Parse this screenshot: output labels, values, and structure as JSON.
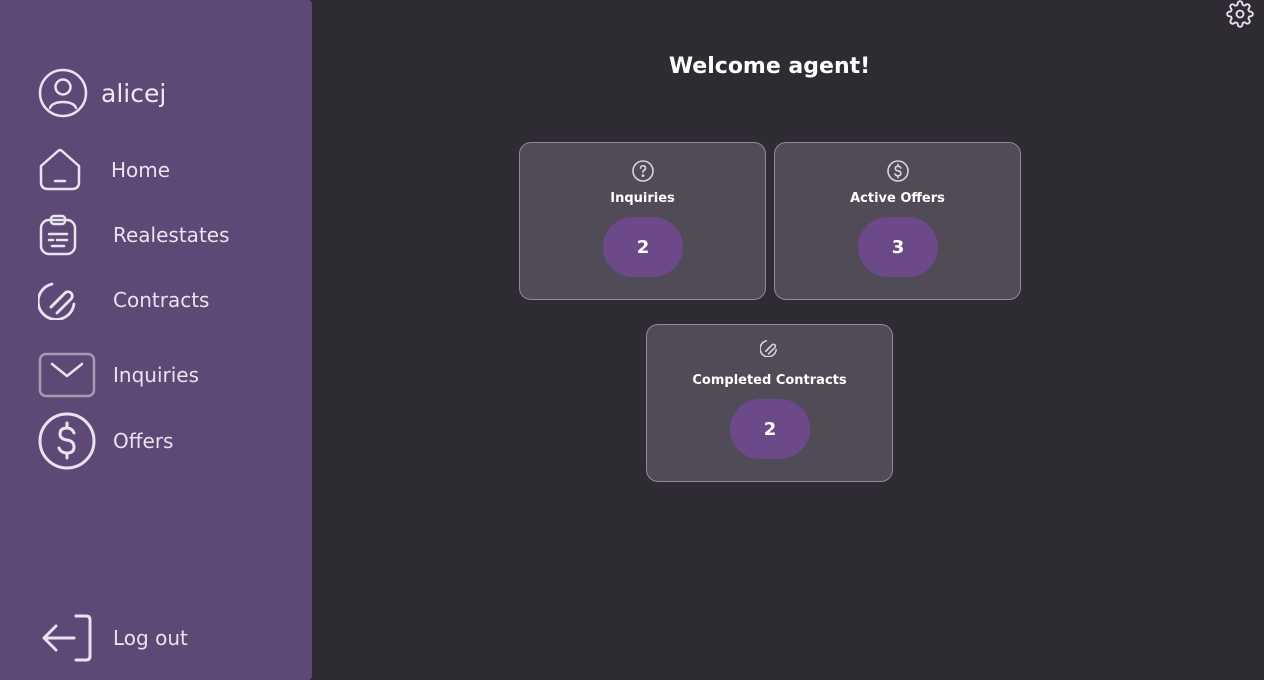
{
  "sidebar": {
    "user": {
      "name": "alicej",
      "icon": "user-circle-icon"
    },
    "items": [
      {
        "label": "Home",
        "icon": "home-icon"
      },
      {
        "label": "Realestates",
        "icon": "clipboard-icon"
      },
      {
        "label": "Contracts",
        "icon": "paperclip-icon"
      },
      {
        "label": "Inquiries",
        "icon": "envelope-icon"
      },
      {
        "label": "Offers",
        "icon": "dollar-circle-icon"
      }
    ],
    "logout": {
      "label": "Log out",
      "icon": "logout-icon"
    }
  },
  "main": {
    "title": "Welcome agent!",
    "settings_icon": "gear-icon",
    "cards": [
      {
        "title": "Inquiries",
        "count": "2",
        "icon": "question-circle-icon"
      },
      {
        "title": "Active Offers",
        "count": "3",
        "icon": "dollar-circle-icon"
      },
      {
        "title": "Completed Contracts",
        "count": "2",
        "icon": "paperclip-icon"
      }
    ]
  },
  "colors": {
    "sidebar": "#5e4876",
    "background": "#2e2b33",
    "card": "#514b58",
    "badge": "#6c4a8a"
  }
}
